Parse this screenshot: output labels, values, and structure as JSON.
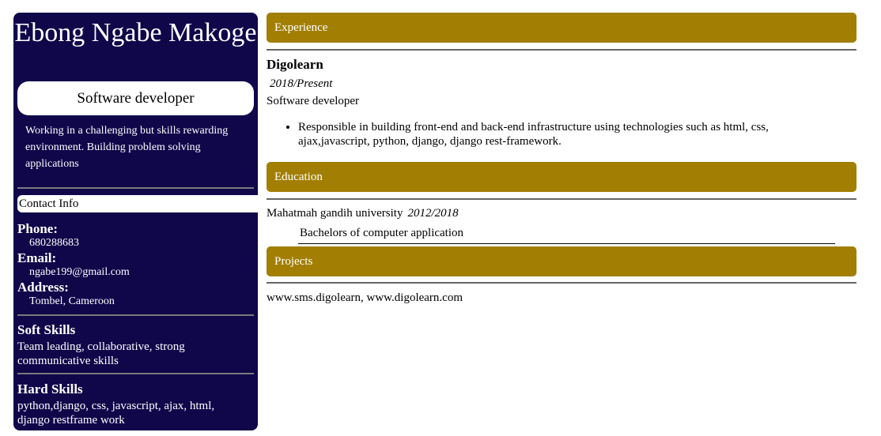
{
  "profile": {
    "name": "Ebong Ngabe Makoge",
    "title": "Software developer",
    "summary": "Working in a challenging but skills rewarding environment. Building problem solving applications"
  },
  "contact": {
    "heading": "Contact Info",
    "phone_label": "Phone:",
    "phone": "680288683",
    "email_label": "Email:",
    "email": "ngabe199@gmail.com",
    "address_label": "Address:",
    "address": "Tombel, Cameroon"
  },
  "soft_skills": {
    "heading": "Soft Skills",
    "text": "Team leading, collaborative, strong communicative skills"
  },
  "hard_skills": {
    "heading": "Hard Skills",
    "text": "python,django, css, javascript, ajax, html, django restframe work"
  },
  "experience": {
    "heading": "Experience",
    "company": "Digolearn",
    "period": "2018/Present",
    "role": "Software developer",
    "responsibilities": [
      "Responsible in building front-end and back-end infrastructure using technologies such as html, css, ajax,javascript, python, django, django rest-framework."
    ]
  },
  "education": {
    "heading": "Education",
    "institution": "Mahatmah gandih university",
    "period": "2012/2018",
    "degree": "Bachelors of computer application"
  },
  "projects": {
    "heading": "Projects",
    "text": "www.sms.digolearn, www.digolearn.com"
  },
  "colors": {
    "sidebar_bg": "#10064a",
    "section_header_bg": "#a27f03"
  }
}
